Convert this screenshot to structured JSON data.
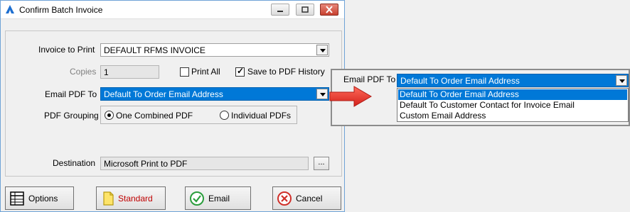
{
  "window": {
    "title": "Confirm Batch Invoice"
  },
  "form": {
    "invoice_label": "Invoice to Print",
    "invoice_value": "DEFAULT RFMS INVOICE",
    "copies_label": "Copies",
    "copies_value": "1",
    "print_all_label": "Print All",
    "print_all_checked": false,
    "save_history_label": "Save to PDF History",
    "save_history_checked": true,
    "email_pdf_label": "Email PDF To",
    "email_pdf_value": "Default To Order Email Address",
    "grouping_label": "PDF Grouping",
    "grouping_options": [
      "One Combined PDF",
      "Individual PDFs"
    ],
    "grouping_selected": "One Combined PDF",
    "destination_label": "Destination",
    "destination_value": "Microsoft Print to PDF",
    "browse_label": "..."
  },
  "buttons": {
    "options": "Options",
    "standard": "Standard",
    "email": "Email",
    "cancel": "Cancel"
  },
  "zoom": {
    "label": "Email PDF To",
    "selected": "Default To Order Email Address",
    "options": [
      "Default To Order Email Address",
      "Default To Customer Contact for Invoice Email",
      "Custom Email Address"
    ]
  },
  "colors": {
    "selection": "#0078d7",
    "arrow": "#e8302a",
    "standard_text": "#c00000"
  }
}
